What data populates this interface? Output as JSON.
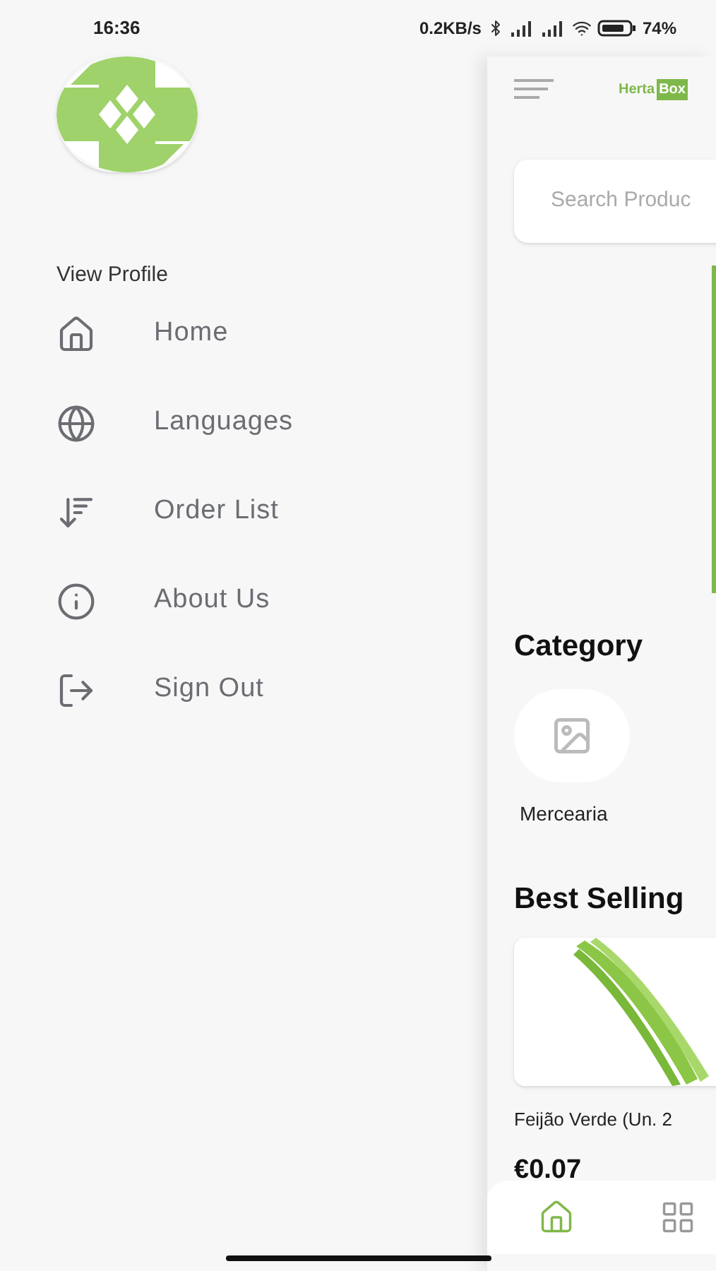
{
  "status_bar": {
    "time": "16:36",
    "speed": "0.2KB/s",
    "battery": "74%"
  },
  "drawer": {
    "profile_link": "View Profile",
    "items": [
      {
        "kind": "home",
        "label": "Home"
      },
      {
        "kind": "globe",
        "label": "Languages"
      },
      {
        "kind": "sort",
        "label": "Order List"
      },
      {
        "kind": "info",
        "label": "About Us"
      },
      {
        "kind": "logout",
        "label": "Sign Out"
      }
    ]
  },
  "main": {
    "logo": {
      "part_1": "Herta",
      "part_2": "Box"
    },
    "search": {
      "placeholder": "Search Produc"
    },
    "category_title": "Category",
    "categories": [
      {
        "label": "Mercearia"
      }
    ],
    "best_selling_title": "Best Selling",
    "products": [
      {
        "name": "Feijão Verde (Un. 2",
        "price": "€0.07"
      }
    ],
    "bottom_nav": [
      {
        "kind": "home",
        "selected": true
      },
      {
        "kind": "grid",
        "selected": false
      }
    ]
  }
}
